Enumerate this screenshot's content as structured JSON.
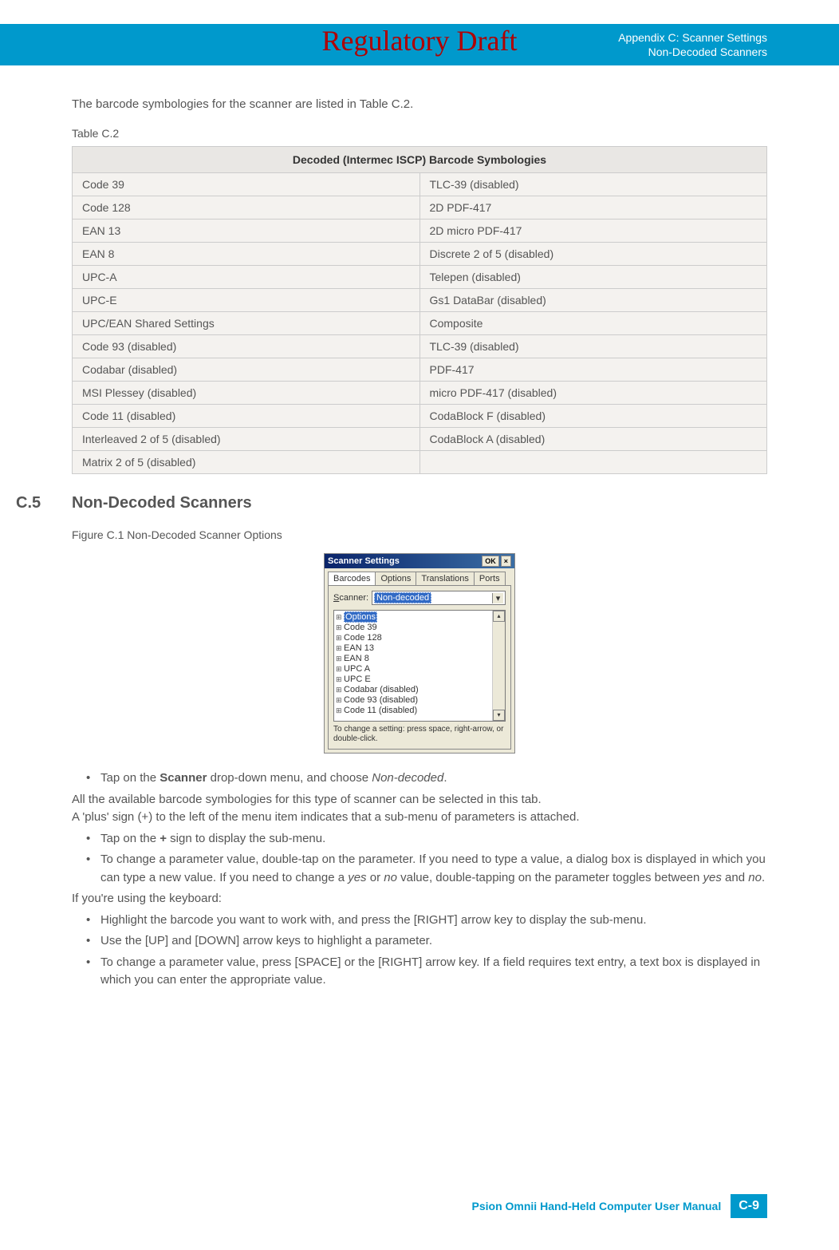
{
  "watermark": "Regulatory Draft",
  "header": {
    "line1": "Appendix C: Scanner Settings",
    "line2": "Non-Decoded Scanners"
  },
  "intro": "The barcode symbologies for the scanner are listed in Table C.2.",
  "table": {
    "label": "Table C.2",
    "header": "Decoded (Intermec ISCP) Barcode Symbologies",
    "rows": [
      [
        "Code 39",
        "TLC-39 (disabled)"
      ],
      [
        "Code 128",
        "2D PDF-417"
      ],
      [
        "EAN 13",
        "2D micro PDF-417"
      ],
      [
        "EAN 8",
        "Discrete 2 of 5 (disabled)"
      ],
      [
        "UPC-A",
        "Telepen (disabled)"
      ],
      [
        "UPC-E",
        "Gs1 DataBar (disabled)"
      ],
      [
        "UPC/EAN Shared Settings",
        "Composite"
      ],
      [
        "Code 93 (disabled)",
        "TLC-39 (disabled)"
      ],
      [
        "Codabar (disabled)",
        "PDF-417"
      ],
      [
        "MSI Plessey (disabled)",
        "micro PDF-417 (disabled)"
      ],
      [
        "Code 11 (disabled)",
        "CodaBlock F (disabled)"
      ],
      [
        "Interleaved 2 of 5 (disabled)",
        "CodaBlock A (disabled)"
      ],
      [
        "Matrix 2 of 5 (disabled)",
        ""
      ]
    ]
  },
  "section": {
    "num": "C.5",
    "title": "Non-Decoded Scanners"
  },
  "figure": {
    "label": "Figure C.1   Non-Decoded Scanner Options"
  },
  "dialog": {
    "title": "Scanner Settings",
    "ok": "OK",
    "close": "×",
    "tabs": [
      "Barcodes",
      "Options",
      "Translations",
      "Ports"
    ],
    "scanner_label": "Scanner:",
    "scanner_value": "Non-decoded",
    "tree": [
      "Options",
      "Code 39",
      "Code 128",
      "EAN 13",
      "EAN 8",
      "UPC A",
      "UPC E",
      "Codabar (disabled)",
      "Code 93 (disabled)",
      "Code 11 (disabled)"
    ],
    "hint": "To change a setting: press space, right-arrow, or double-click."
  },
  "body": {
    "b1_pre": "Tap on the ",
    "b1_bold": "Scanner",
    "b1_mid": " drop-down menu, and choose ",
    "b1_italic": "Non-decoded",
    "b1_end": ".",
    "p1": "All the available barcode symbologies for this type of scanner can be selected in this tab.",
    "p2": "A 'plus' sign (+) to the left of the menu item indicates that a sub-menu of parameters is attached.",
    "b2_pre": "Tap on the ",
    "b2_bold": "+",
    "b2_end": " sign to display the sub-menu.",
    "b3_pre": "To change a parameter value, double-tap on the parameter. If you need to type a value, a dialog box is displayed in which you can type a new value. If you need to change a ",
    "b3_i1": "yes",
    "b3_mid": " or ",
    "b3_i2": "no",
    "b3_mid2": " value, double-tapping on the parameter toggles between ",
    "b3_i3": "yes",
    "b3_mid3": " and ",
    "b3_i4": "no",
    "b3_end": ".",
    "p3": "If you're using the keyboard:",
    "b4": "Highlight the barcode you want to work with, and press the [RIGHT] arrow key to display the sub-menu.",
    "b5": "Use the [UP] and [DOWN] arrow keys to highlight a parameter.",
    "b6": "To change a parameter value, press [SPACE] or the [RIGHT] arrow key. If a field requires text entry, a text box is displayed in which you can enter the appropriate value."
  },
  "footer": {
    "text": "Psion Omnii Hand-Held Computer User Manual",
    "page": "C-9"
  }
}
